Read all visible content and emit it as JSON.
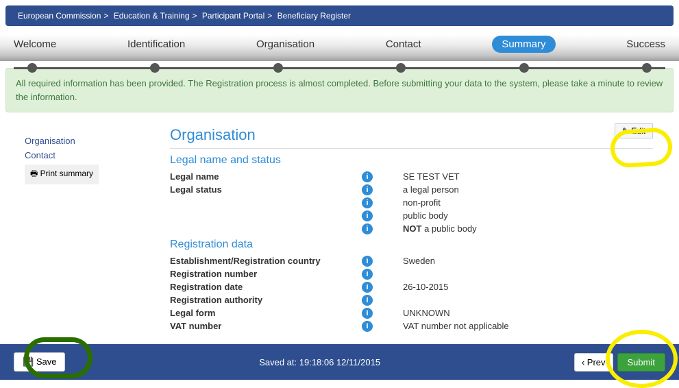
{
  "breadcrumb": [
    "European Commission",
    "Education & Training",
    "Participant Portal",
    "Beneficiary Register"
  ],
  "steps": {
    "welcome": "Welcome",
    "identification": "Identification",
    "organisation": "Organisation",
    "contact": "Contact",
    "summary": "Summary",
    "success": "Success"
  },
  "alert": "All required information has been provided. The Registration process is almost completed. Before submitting your data to the system, please take a minute to review the information.",
  "sidenav": {
    "organisation": "Organisation",
    "contact": "Contact",
    "print": "Print summary"
  },
  "content": {
    "title": "Organisation",
    "edit": "Edit",
    "sub1": "Legal name and status",
    "legal_name_label": "Legal name",
    "legal_name_value": "SE TEST VET",
    "legal_status_label": "Legal status",
    "legal_status_v1": "a legal person",
    "legal_status_v2": "non-profit",
    "legal_status_v3": "public body",
    "legal_status_v4_prefix": "NOT",
    "legal_status_v4_rest": " a public body",
    "sub2": "Registration data",
    "est_country_label": "Establishment/Registration country",
    "est_country_value": "Sweden",
    "reg_number_label": "Registration number",
    "reg_number_value": "",
    "reg_date_label": "Registration date",
    "reg_date_value": "26-10-2015",
    "reg_auth_label": "Registration authority",
    "reg_auth_value": "",
    "legal_form_label": "Legal form",
    "legal_form_value": "UNKNOWN",
    "vat_label": "VAT number",
    "vat_value": "VAT number not applicable"
  },
  "footer": {
    "save": "Save",
    "saved_at": "Saved at: 19:18:06 12/11/2015",
    "prev": "Prev",
    "submit": "Submit"
  }
}
